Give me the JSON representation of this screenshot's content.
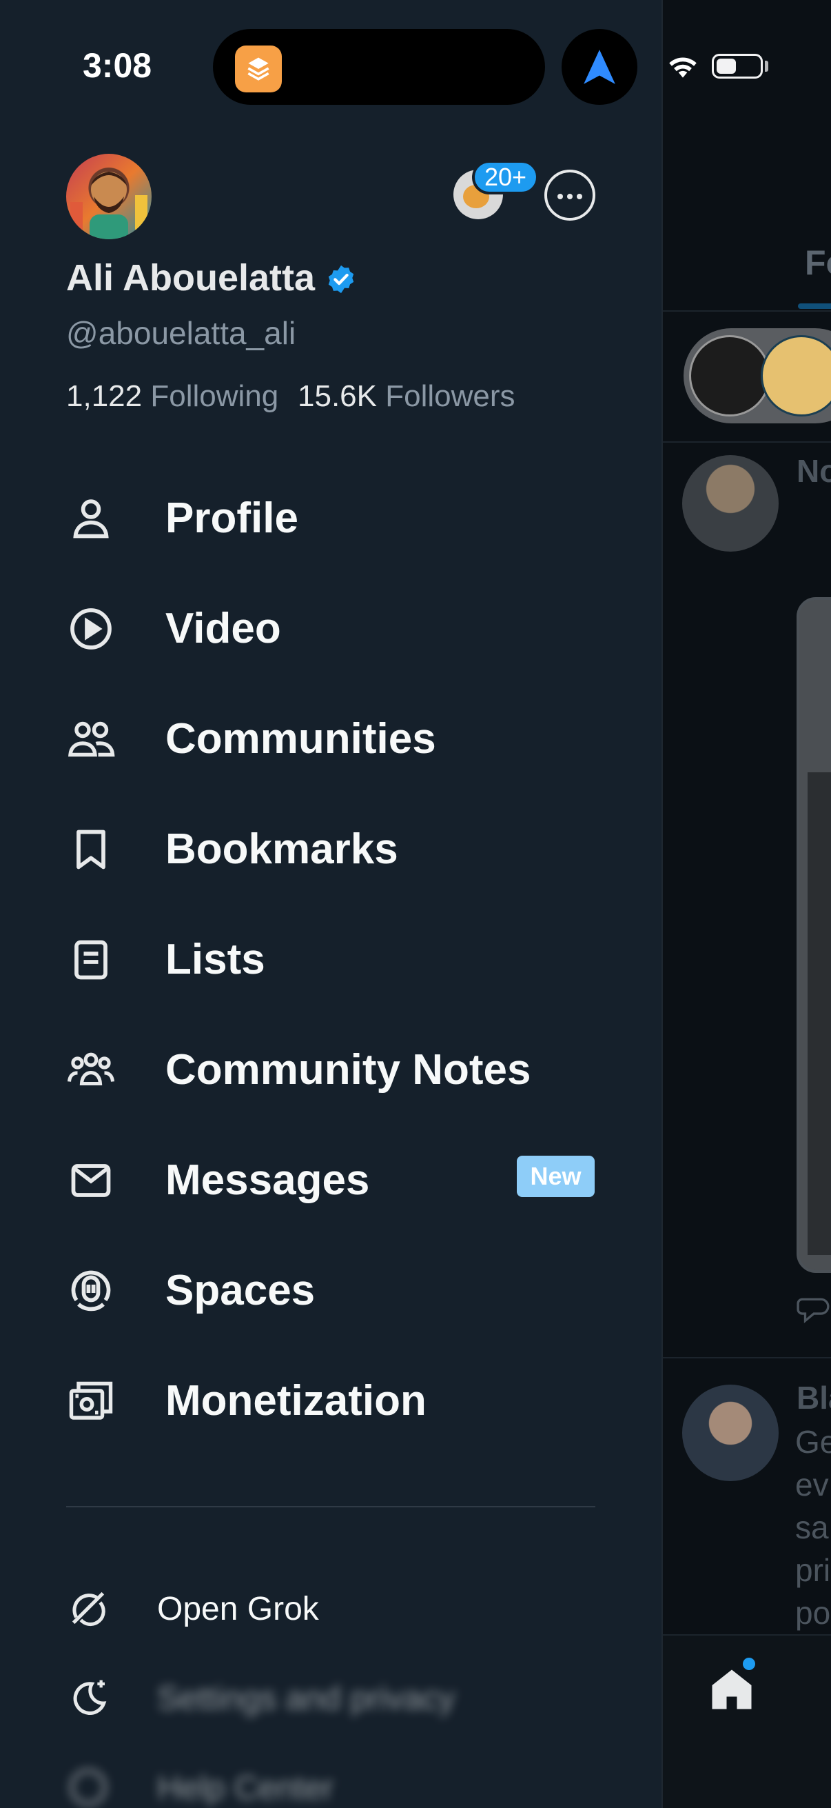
{
  "status_bar": {
    "time": "3:08"
  },
  "profile": {
    "display_name": "Ali Abouelatta",
    "handle": "@abouelatta_ali",
    "following_count": "1,122",
    "following_label": "Following",
    "followers_count": "15.6K",
    "followers_label": "Followers",
    "account_badge": "20+"
  },
  "menu": {
    "items": [
      {
        "label": "Profile",
        "icon": "person-icon"
      },
      {
        "label": "Video",
        "icon": "play-circle-icon"
      },
      {
        "label": "Communities",
        "icon": "communities-icon"
      },
      {
        "label": "Bookmarks",
        "icon": "bookmark-icon"
      },
      {
        "label": "Lists",
        "icon": "list-icon"
      },
      {
        "label": "Community Notes",
        "icon": "community-notes-icon"
      },
      {
        "label": "Messages",
        "icon": "envelope-icon",
        "badge": "New"
      },
      {
        "label": "Spaces",
        "icon": "spaces-icon"
      },
      {
        "label": "Monetization",
        "icon": "money-icon"
      }
    ]
  },
  "secondary": {
    "items": [
      {
        "label": "Open Grok",
        "icon": "grok-icon"
      },
      {
        "label": "Settings and privacy",
        "icon": "moon-icon"
      },
      {
        "label": "Help Center",
        "icon": "help-icon"
      }
    ]
  },
  "timeline": {
    "tab_label": "Fo",
    "post1_author": "No",
    "post2_author": "Bla",
    "post2_lines": [
      "Ge",
      "ev",
      "sa",
      "pri",
      "po"
    ]
  },
  "colors": {
    "background": "#15202b",
    "accent": "#1d9bf0",
    "new_badge": "#8ecdf8",
    "muted_text": "#8b98a5"
  }
}
